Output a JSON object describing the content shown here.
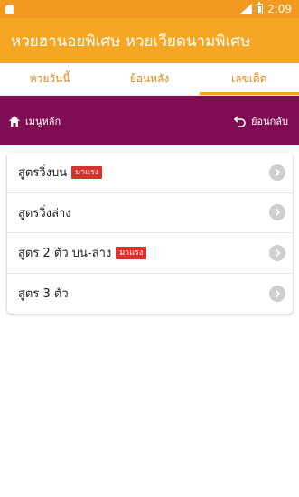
{
  "status_bar": {
    "time": "2:09"
  },
  "app_bar": {
    "title": "หวยฮานอยพิเศษ หวยเวียดนามพิเศษ"
  },
  "tabs": [
    {
      "label": "หวยวันนี้",
      "active": false
    },
    {
      "label": "ย้อนหลัง",
      "active": false
    },
    {
      "label": "เลขเด็ด",
      "active": true
    }
  ],
  "nav": {
    "home_label": "เมนูหลัก",
    "back_label": "ย้อนกลับ"
  },
  "menu": [
    {
      "label": "สูตรวิ่งบน",
      "badge": "มาแรง"
    },
    {
      "label": "สูตรวิ่งล่าง",
      "badge": ""
    },
    {
      "label": "สูตร 2 ตัว บน-ล่าง",
      "badge": "มาแรง"
    },
    {
      "label": "สูตร 3 ตัว",
      "badge": ""
    }
  ],
  "colors": {
    "status_bar": "#f29a1f",
    "app_bar": "#f5a623",
    "tab_text": "#e2891d",
    "nav_bar": "#7f0d53",
    "badge": "#d9312b"
  }
}
